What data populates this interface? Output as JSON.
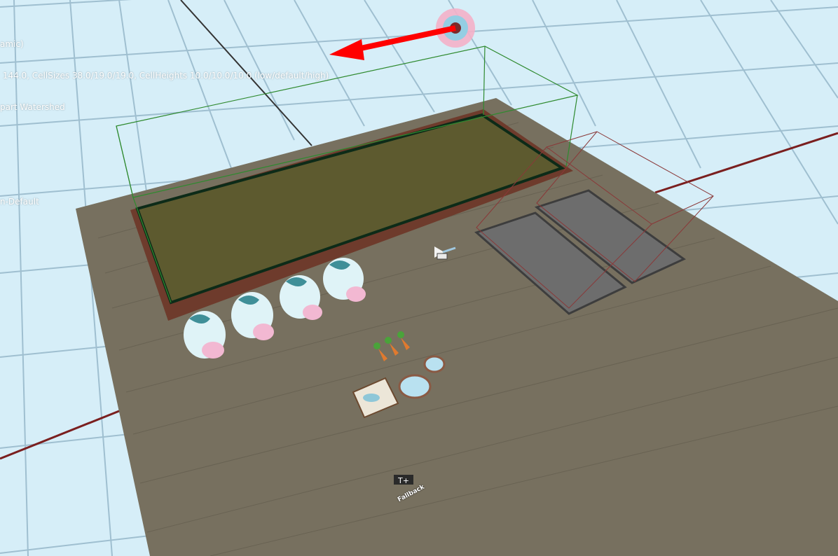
{
  "overlay": {
    "lines": [
      "amic)",
      " 144.0, CellSizes 38.0/19.0/19.0, CellHeights 10.0/10.0/10.0 (low/default/high)",
      "part Watershed",
      "",
      "",
      "n-Default"
    ]
  },
  "scene": {
    "floor_color": "#d6eef8",
    "grid_color": "#8ab0c4",
    "platform_color": "#77705f",
    "field_color": "#5d5a2f",
    "border_color": "#6e3b2c",
    "navmesh_color": "#1e7a1e",
    "bounds_color": "#7a2a2a",
    "gizmo_arrow_color": "#ff0000",
    "cow_count": 4,
    "carrot_count": 3
  },
  "gizmo": {
    "fallback_label": "Fallback"
  }
}
